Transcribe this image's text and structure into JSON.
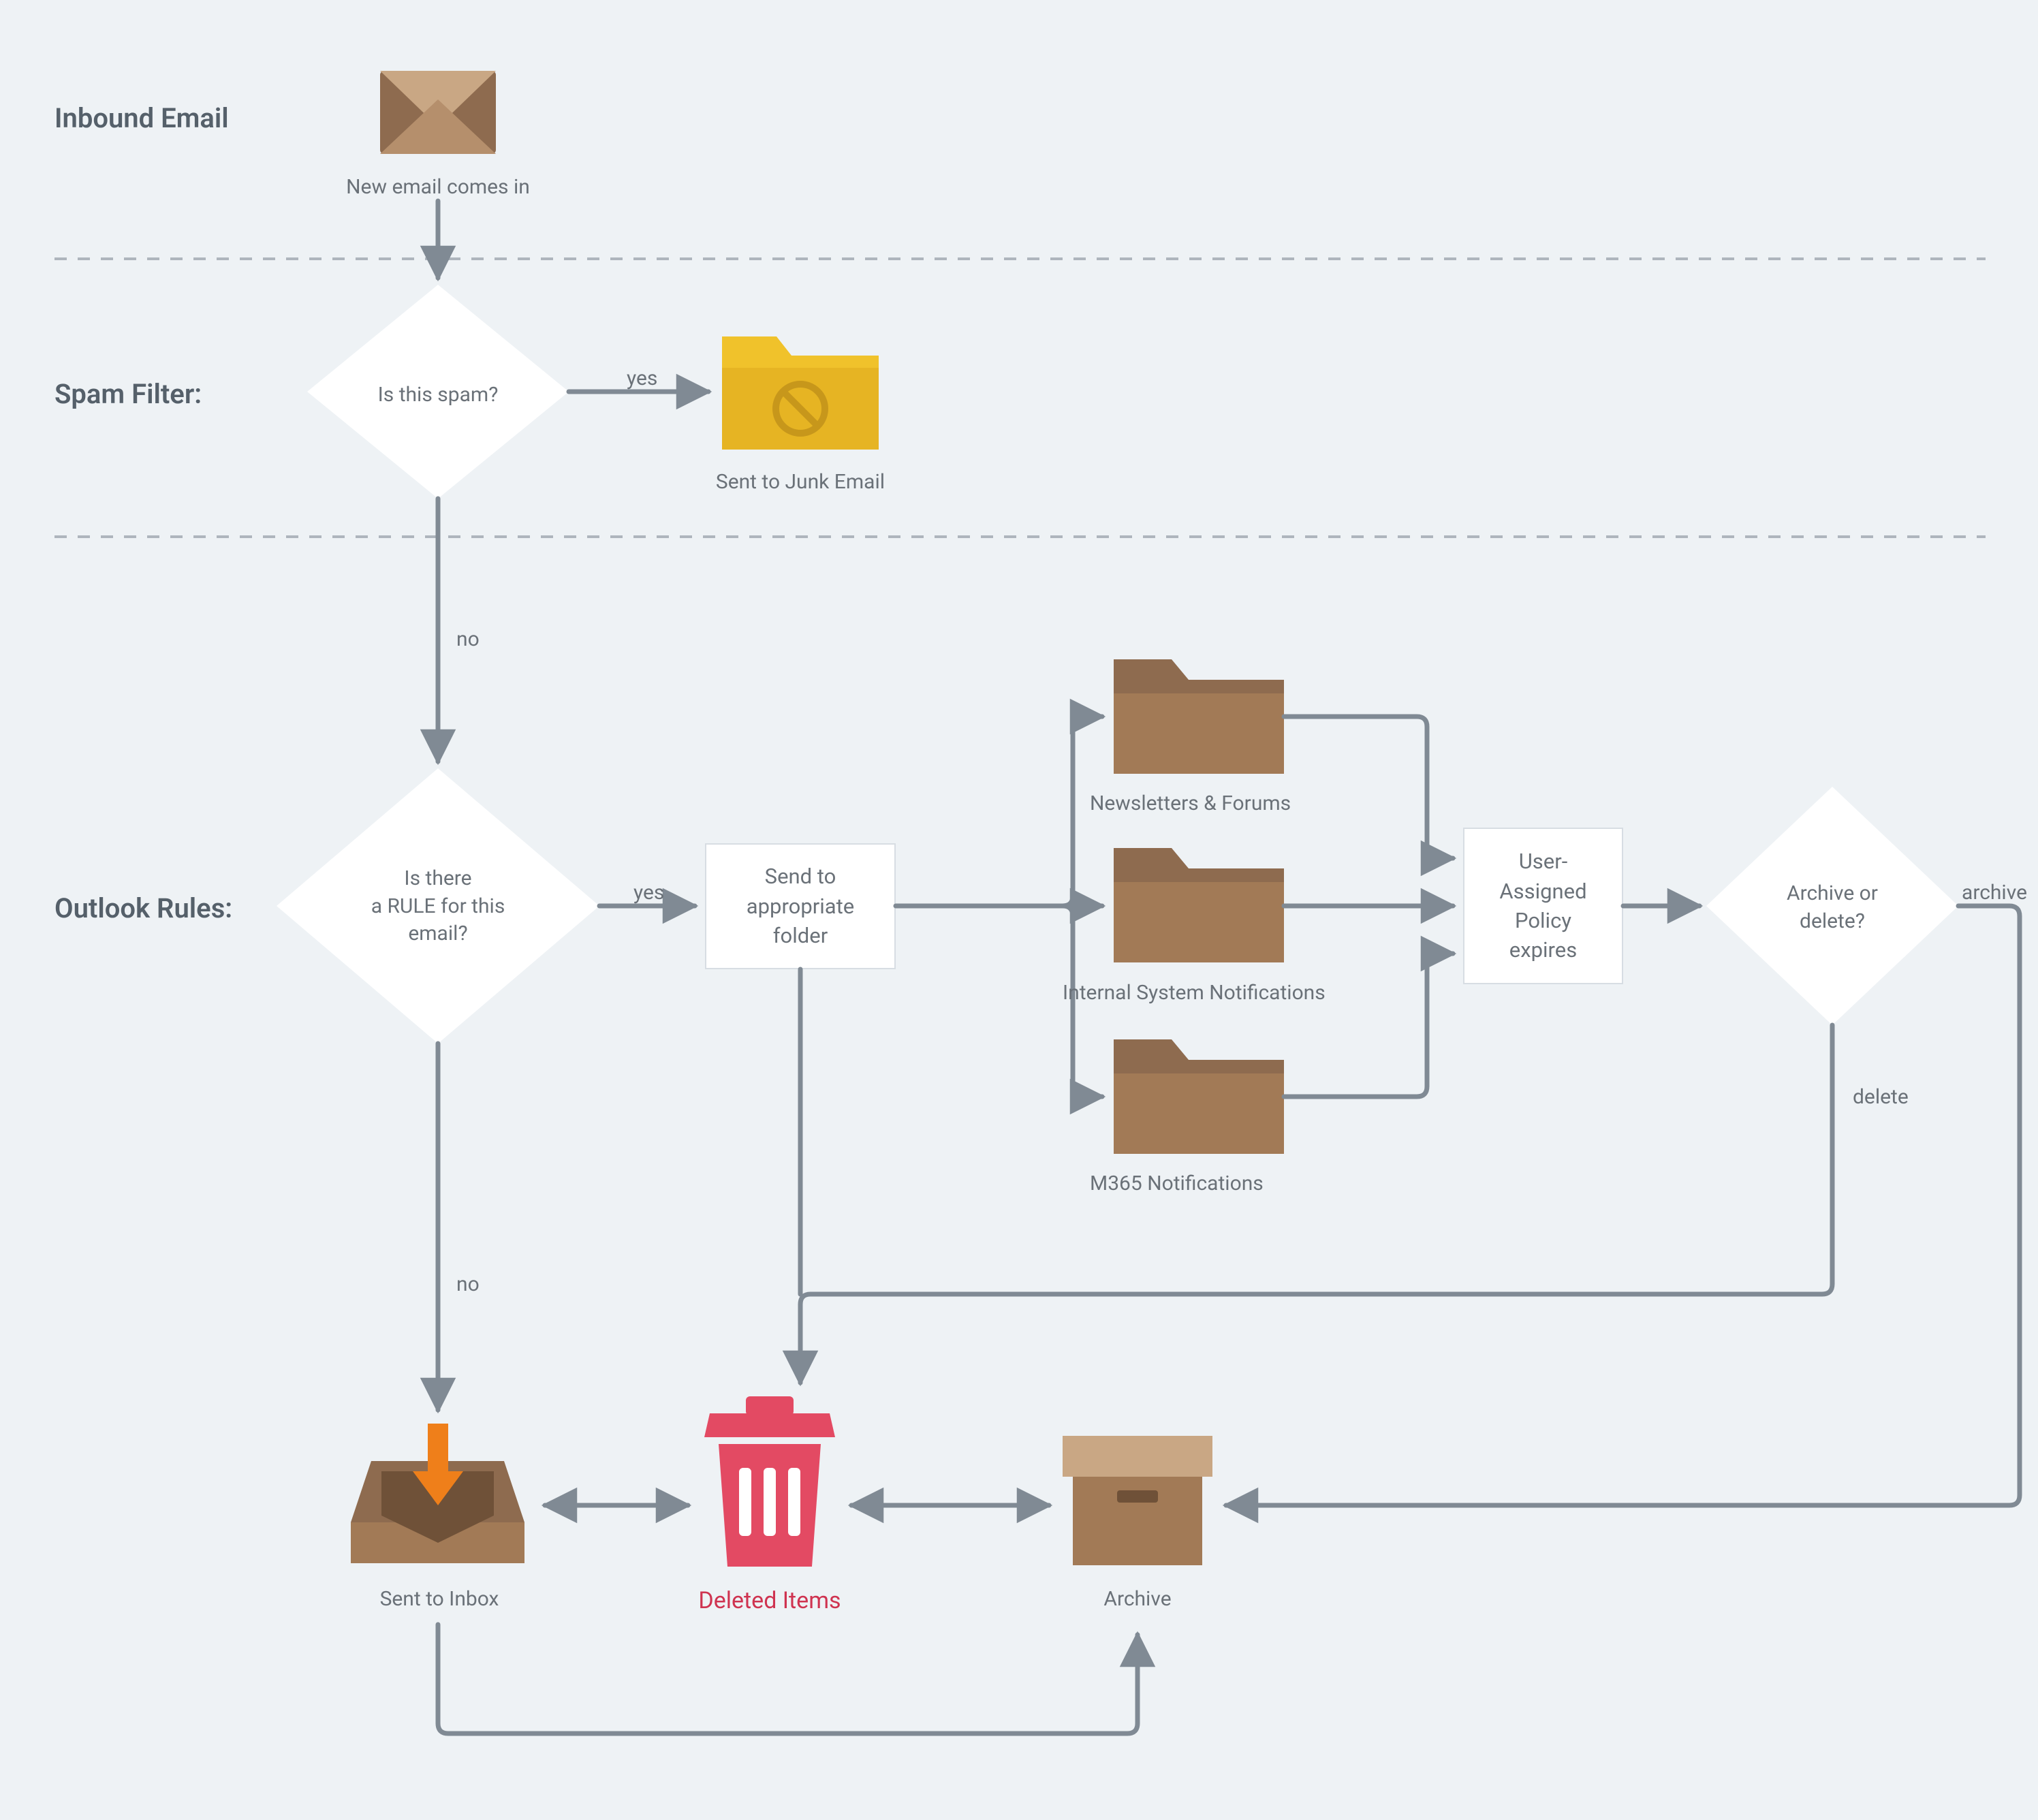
{
  "sections": {
    "inbound": "Inbound Email",
    "spam": "Spam Filter:",
    "rules": "Outlook Rules:"
  },
  "nodes": {
    "new_email": "New email comes in",
    "is_spam": "Is this spam?",
    "junk": "Sent to Junk Email",
    "rule_q_line1": "Is there",
    "rule_q_line2": "a RULE for this",
    "rule_q_line3": "email?",
    "send_folder_line1": "Send to",
    "send_folder_line2": "appropriate",
    "send_folder_line3": "folder",
    "folder_newsletters": "Newsletters & Forums",
    "folder_internal": "Internal System Notifications",
    "folder_m365": "M365 Notifications",
    "policy_line1": "User-",
    "policy_line2": "Assigned",
    "policy_line3": "Policy",
    "policy_line4": "expires",
    "archive_delete_line1": "Archive or",
    "archive_delete_line2": "delete?",
    "inbox": "Sent to Inbox",
    "deleted": "Deleted Items",
    "archive": "Archive"
  },
  "edges": {
    "yes1": "yes",
    "no1": "no",
    "yes2": "yes",
    "no2": "no",
    "archive": "archive",
    "delete": "delete"
  }
}
